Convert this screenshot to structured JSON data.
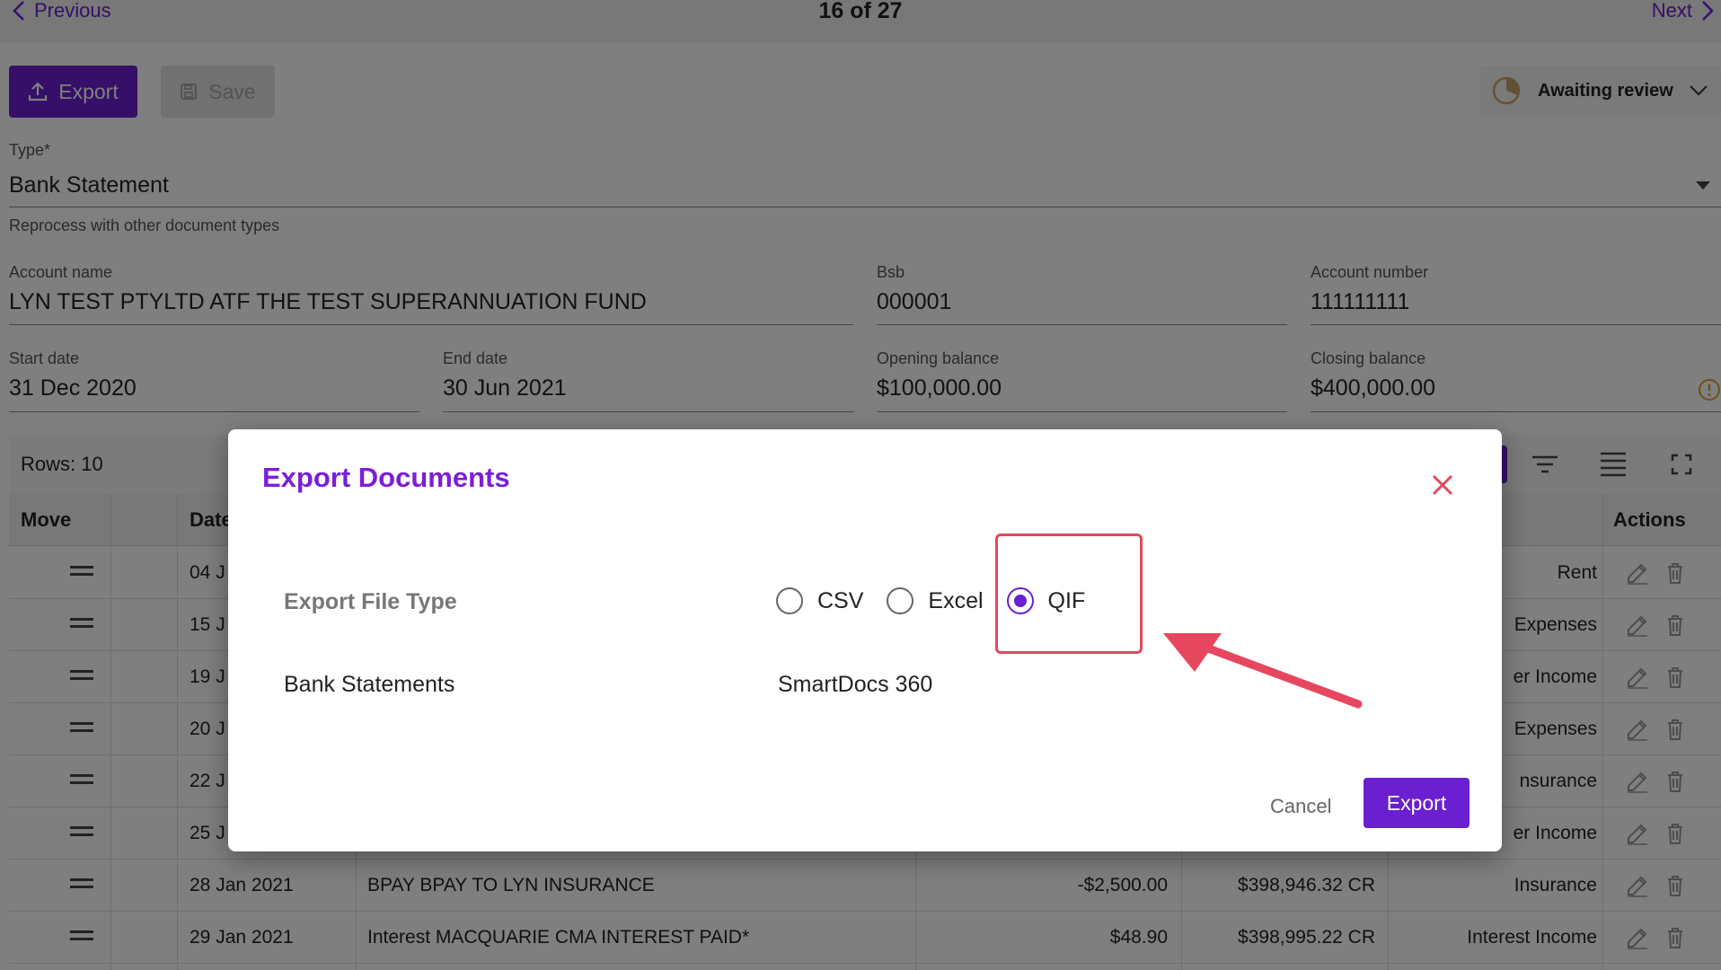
{
  "pager": {
    "previous": "Previous",
    "count": "16 of 27",
    "next": "Next"
  },
  "toolbar": {
    "export": "Export",
    "save": "Save"
  },
  "status": {
    "label": "Awaiting review"
  },
  "type_field": {
    "label": "Type",
    "required_mark": "*",
    "value": "Bank Statement",
    "helper": "Reprocess with other document types"
  },
  "fields": {
    "account_name": {
      "label": "Account name",
      "value": "LYN TEST PTYLTD ATF THE TEST SUPERANNUATION FUND"
    },
    "bsb": {
      "label": "Bsb",
      "value": "000001"
    },
    "account_number": {
      "label": "Account number",
      "value": "111111111"
    },
    "start_date": {
      "label": "Start date",
      "value": "31 Dec 2020"
    },
    "end_date": {
      "label": "End date",
      "value": "30 Jun 2021"
    },
    "opening_balance": {
      "label": "Opening balance",
      "value": "$100,000.00"
    },
    "closing_balance": {
      "label": "Closing balance",
      "value": "$400,000.00"
    }
  },
  "table": {
    "rows_label": "Rows: 10",
    "headers": {
      "move": "Move",
      "date": "Date",
      "actions": "Actions"
    },
    "rows": [
      {
        "date": "04 J",
        "description": "",
        "amount": "",
        "balance": "",
        "category": "Rent"
      },
      {
        "date": "15 J",
        "description": "",
        "amount": "",
        "balance": "",
        "category": "Expenses"
      },
      {
        "date": "19 J",
        "description": "",
        "amount": "",
        "balance": "",
        "category": "er Income"
      },
      {
        "date": "20 J",
        "description": "",
        "amount": "",
        "balance": "",
        "category": "Expenses"
      },
      {
        "date": "22 J",
        "description": "",
        "amount": "",
        "balance": "",
        "category": "nsurance"
      },
      {
        "date": "25 J",
        "description": "",
        "amount": "",
        "balance": "",
        "category": "er Income"
      },
      {
        "date": "28 Jan 2021",
        "description": "BPAY BPAY TO LYN INSURANCE",
        "amount": "-$2,500.00",
        "balance": "$398,946.32 CR",
        "category": "Insurance"
      },
      {
        "date": "29 Jan 2021",
        "description": "Interest MACQUARIE CMA INTEREST PAID*",
        "amount": "$48.90",
        "balance": "$398,995.22 CR",
        "category": "Interest Income"
      }
    ]
  },
  "dialog": {
    "title": "Export Documents",
    "file_type_label": "Export File Type",
    "options": [
      "CSV",
      "Excel",
      "QIF"
    ],
    "selected_option": "QIF",
    "row_label": "Bank Statements",
    "row_value": "SmartDocs 360",
    "cancel": "Cancel",
    "export": "Export"
  },
  "colors": {
    "accent": "#6a1fd0",
    "highlight": "#e5475e",
    "title": "#7b1fd6"
  }
}
